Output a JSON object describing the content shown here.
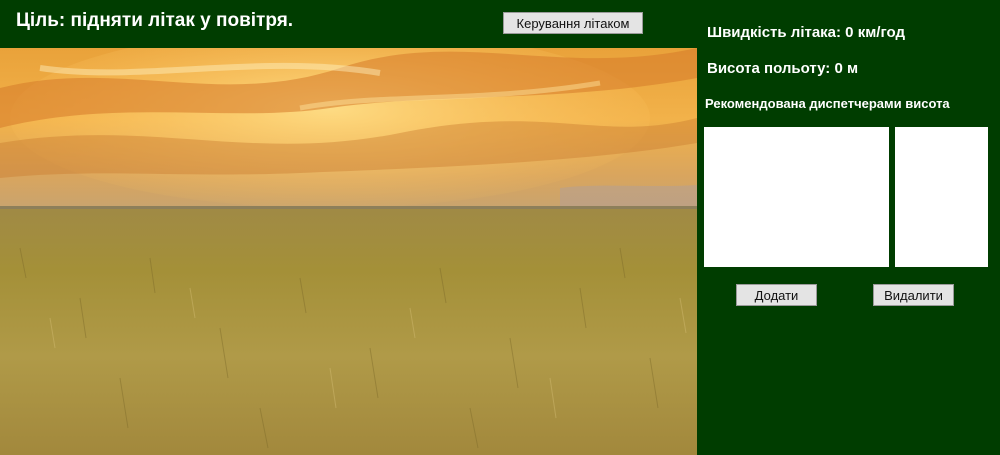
{
  "header": {
    "goal_title": "Ціль: підняти літак у повітря.",
    "control_button_label": "Керування літаком"
  },
  "status": {
    "speed_text": "Швидкість літака: 0 км/год",
    "altitude_text": "Висота польоту: 0 м"
  },
  "recommendations": {
    "heading": "Рекомендована диспетчерами висота",
    "add_button_label": "Додати",
    "remove_button_label": "Видалити"
  },
  "scene": {
    "description_icon": "wheat-field-sunset-image"
  },
  "colors": {
    "page_background": "#003d00",
    "text": "#ffffff",
    "button_background": "#e4e4e4",
    "listbox_background": "#ffffff"
  }
}
